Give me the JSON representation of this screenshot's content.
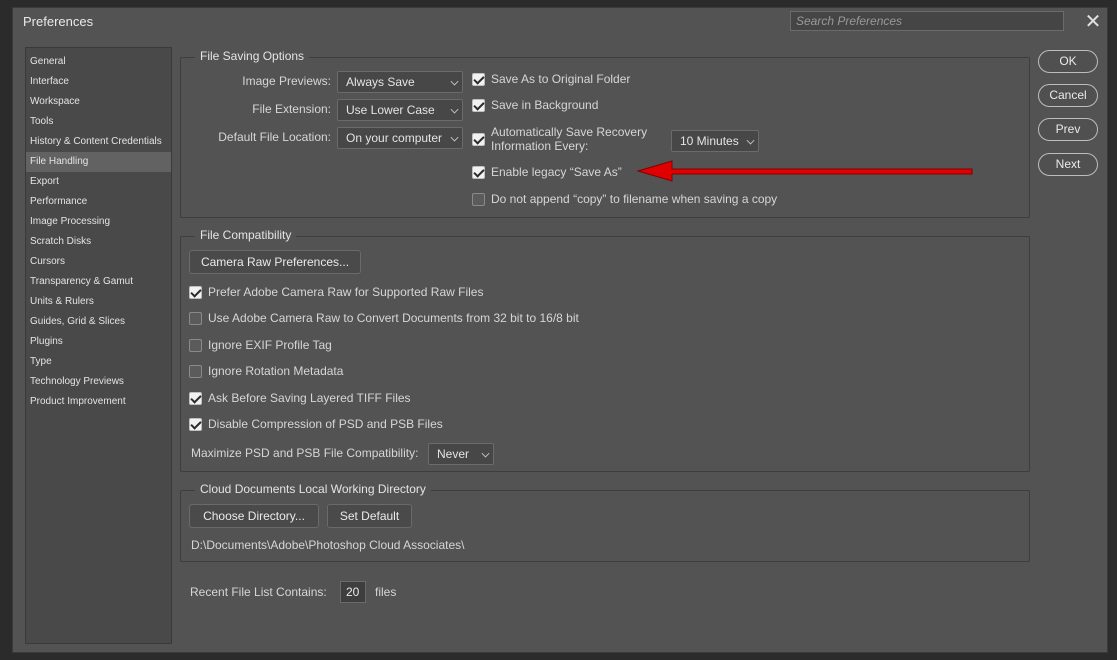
{
  "window": {
    "title": "Preferences",
    "search_placeholder": "Search Preferences"
  },
  "sidebar": {
    "items": [
      {
        "label": "General"
      },
      {
        "label": "Interface"
      },
      {
        "label": "Workspace"
      },
      {
        "label": "Tools"
      },
      {
        "label": "History & Content Credentials"
      },
      {
        "label": "File Handling"
      },
      {
        "label": "Export"
      },
      {
        "label": "Performance"
      },
      {
        "label": "Image Processing"
      },
      {
        "label": "Scratch Disks"
      },
      {
        "label": "Cursors"
      },
      {
        "label": "Transparency & Gamut"
      },
      {
        "label": "Units & Rulers"
      },
      {
        "label": "Guides, Grid & Slices"
      },
      {
        "label": "Plugins"
      },
      {
        "label": "Type"
      },
      {
        "label": "Technology Previews"
      },
      {
        "label": "Product Improvement"
      }
    ],
    "selected": "File Handling"
  },
  "file_saving": {
    "title": "File Saving Options",
    "image_previews_label": "Image Previews:",
    "image_previews_value": "Always Save",
    "file_extension_label": "File Extension:",
    "file_extension_value": "Use Lower Case",
    "default_location_label": "Default File Location:",
    "default_location_value": "On your computer",
    "save_as_original": {
      "label": "Save As to Original Folder",
      "checked": true
    },
    "save_background": {
      "label": "Save in Background",
      "checked": true
    },
    "auto_recovery": {
      "label_1": "Automatically Save Recovery",
      "label_2": "Information Every:",
      "checked": true
    },
    "recovery_interval": "10 Minutes",
    "legacy_save_as": {
      "label": "Enable legacy “Save As”",
      "checked": true
    },
    "no_copy": {
      "label": "Do not append “copy” to filename when saving a copy",
      "checked": false
    }
  },
  "file_compat": {
    "title": "File Compatibility",
    "camera_raw_button": "Camera Raw Preferences...",
    "prefer_acr": {
      "label": "Prefer Adobe Camera Raw for Supported Raw Files",
      "checked": true
    },
    "use_acr_convert": {
      "label": "Use Adobe Camera Raw to Convert Documents from 32 bit to 16/8 bit",
      "checked": false
    },
    "ignore_exif": {
      "label": "Ignore EXIF Profile Tag",
      "checked": false
    },
    "ignore_rotation": {
      "label": "Ignore Rotation Metadata",
      "checked": false
    },
    "ask_tiff": {
      "label": "Ask Before Saving Layered TIFF Files",
      "checked": true
    },
    "disable_compression": {
      "label": "Disable Compression of PSD and PSB Files",
      "checked": true
    },
    "maximize_label": "Maximize PSD and PSB File Compatibility:",
    "maximize_value": "Never"
  },
  "cloud_docs": {
    "title": "Cloud Documents Local Working Directory",
    "choose_button": "Choose Directory...",
    "default_button": "Set Default",
    "path": "D:\\Documents\\Adobe\\Photoshop Cloud Associates\\"
  },
  "recent": {
    "label": "Recent File List Contains:",
    "value": "20",
    "suffix": "files"
  },
  "buttons": {
    "ok": "OK",
    "cancel": "Cancel",
    "prev": "Prev",
    "next": "Next"
  },
  "colors": {
    "window_bg": "#535353",
    "annotation_arrow": "#e00000"
  }
}
